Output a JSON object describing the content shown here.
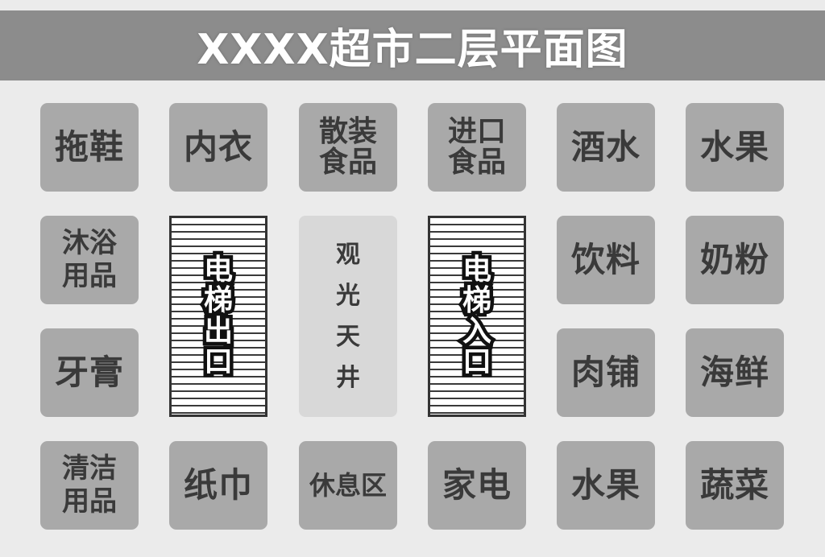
{
  "title": "XXXX超市二层平面图",
  "rows": {
    "row1": [
      "拖鞋",
      "内衣",
      "散装食品",
      "进口食品",
      "酒水",
      "水果"
    ],
    "row2": [
      "沐浴用品",
      "饮料",
      "奶粉"
    ],
    "row3": [
      "牙膏",
      "肉铺",
      "海鲜"
    ],
    "row4": [
      "清洁用品",
      "纸巾",
      "休息区",
      "家电",
      "水果",
      "蔬菜"
    ]
  },
  "elevator_exit": "电梯出口",
  "elevator_entrance": "电梯入口",
  "atrium": "观光天井",
  "colors": {
    "background": "#ebebeb",
    "title_bar": "#8c8c8c",
    "tile": "#a9a9a9",
    "atrium": "#d8d8d8",
    "tile_text": "#3a3a3a"
  }
}
